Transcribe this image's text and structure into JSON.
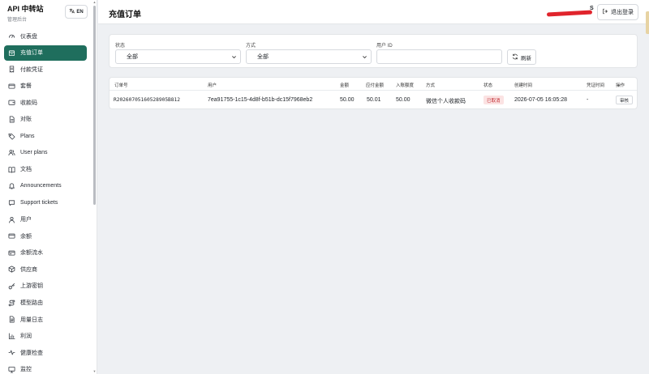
{
  "brand": {
    "title": "API 中转站",
    "subtitle": "管理后台"
  },
  "lang_button": {
    "label": "EN",
    "icon": "language-icon"
  },
  "nav": [
    {
      "label": "仪表盘",
      "icon": "gauge-icon",
      "active": false
    },
    {
      "label": "充值订单",
      "icon": "box-icon",
      "active": true
    },
    {
      "label": "付款凭证",
      "icon": "receipt-icon",
      "active": false
    },
    {
      "label": "套餐",
      "icon": "card-icon",
      "active": false
    },
    {
      "label": "收款码",
      "icon": "wallet-icon",
      "active": false
    },
    {
      "label": "对账",
      "icon": "doc-icon",
      "active": false
    },
    {
      "label": "Plans",
      "icon": "tag-icon",
      "active": false
    },
    {
      "label": "User plans",
      "icon": "users-icon",
      "active": false
    },
    {
      "label": "文档",
      "icon": "book-icon",
      "active": false
    },
    {
      "label": "Announcements",
      "icon": "bell-icon",
      "active": false
    },
    {
      "label": "Support tickets",
      "icon": "chat-icon",
      "active": false
    },
    {
      "label": "用户",
      "icon": "user-icon",
      "active": false
    },
    {
      "label": "余额",
      "icon": "card-icon",
      "active": false
    },
    {
      "label": "余额流水",
      "icon": "flow-icon",
      "active": false
    },
    {
      "label": "供应商",
      "icon": "cube-icon",
      "active": false
    },
    {
      "label": "上游密钥",
      "icon": "key-icon",
      "active": false
    },
    {
      "label": "模型路由",
      "icon": "route-icon",
      "active": false
    },
    {
      "label": "用量日志",
      "icon": "log-icon",
      "active": false
    },
    {
      "label": "利润",
      "icon": "bar-chart-icon",
      "active": false
    },
    {
      "label": "健康检查",
      "icon": "pulse-icon",
      "active": false
    },
    {
      "label": "监控",
      "icon": "monitor-icon",
      "active": false
    }
  ],
  "header": {
    "title": "充值订单",
    "user_initial": "S",
    "logout_label": "退出登录"
  },
  "filters": {
    "status_label": "状态",
    "status_value": "全部",
    "method_label": "方式",
    "method_value": "全部",
    "user_id_label": "用户 ID",
    "user_id_value": "",
    "refresh_label": "刷新"
  },
  "table": {
    "columns": [
      "订单号",
      "用户",
      "金额",
      "应付金额",
      "入账额度",
      "方式",
      "状态",
      "创建时间",
      "凭证时间",
      "操作"
    ],
    "rows": [
      {
        "order_no": "R20260705160528905B812",
        "user": "7ea91755-1c15-4d8f-b51b-dc15f7968eb2",
        "amount": "50.00",
        "payable": "50.01",
        "credit": "50.00",
        "method": "微信个人收款码",
        "status": "已取消",
        "created": "2026-07-05 16:05:28",
        "proof_time": "-",
        "action": "审核"
      }
    ]
  },
  "colors": {
    "accent": "#1f6e5d",
    "danger_bg": "#fbe3e3",
    "danger_text": "#c0282f",
    "page_bg": "#eef0f3"
  }
}
